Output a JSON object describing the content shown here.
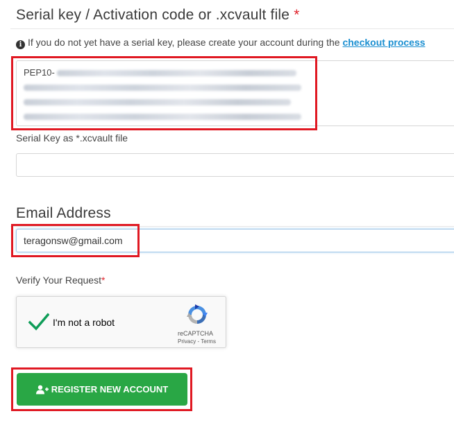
{
  "serial_section": {
    "title": "Serial key / Activation code or .xcvault file",
    "required_mark": "*",
    "info_text": "If you do not yet have a serial key, please create your account during the ",
    "info_link": "checkout process",
    "info_icon": "info-circle-icon",
    "serial_prefix": "PEP10-",
    "xcvault_label": "Serial Key as *.xcvault file",
    "xcvault_value": ""
  },
  "email_section": {
    "title": "Email Address",
    "value": "teragonsw@gmail.com"
  },
  "verify": {
    "label": "Verify Your Request",
    "required_mark": "*",
    "recaptcha_label": "I'm not a robot",
    "recaptcha_brand": "reCAPTCHA",
    "recaptcha_links": "Privacy - Terms",
    "checked": true
  },
  "register_button": {
    "label": "REGISTER NEW ACCOUNT",
    "icon": "user-plus-icon"
  },
  "colors": {
    "required": "#e0232c",
    "link": "#1a8fd1",
    "button": "#29a745",
    "highlight": "#e01822",
    "check": "#0f9d58"
  }
}
